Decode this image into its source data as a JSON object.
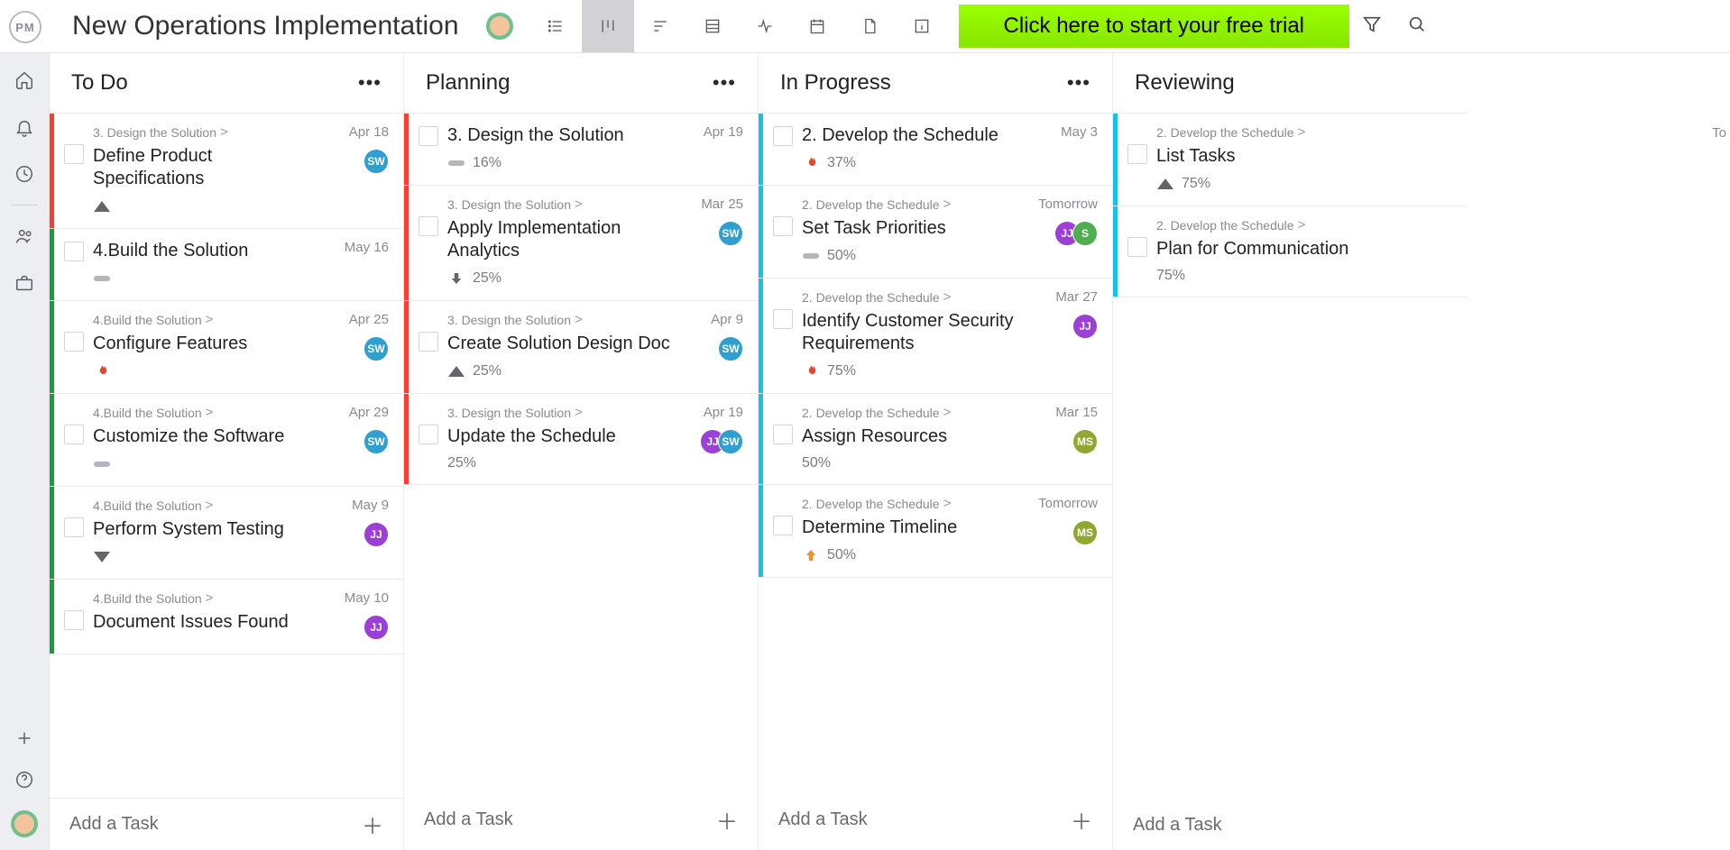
{
  "brand": "PM",
  "project_title": "New Operations Implementation",
  "trial_button": "Click here to start your free trial",
  "add_task_label": "Add a Task",
  "peek_text": "To",
  "columns": [
    {
      "title": "To Do",
      "add_style": "footer",
      "cards": [
        {
          "parent": "3. Design the Solution",
          "title": "Define Product Specifications",
          "date": "Apr 18",
          "pct": "",
          "priority": "up_gray",
          "bar": "red",
          "avatars": [
            "SW"
          ]
        },
        {
          "parent": "",
          "title": "4.Build the Solution",
          "date": "May 16",
          "pct": "",
          "priority": "dash",
          "bar": "green",
          "avatars": []
        },
        {
          "parent": "4.Build the Solution",
          "title": "Configure Features",
          "date": "Apr 25",
          "pct": "",
          "priority": "fire",
          "bar": "green",
          "avatars": [
            "SW"
          ]
        },
        {
          "parent": "4.Build the Solution",
          "title": "Customize the Software",
          "date": "Apr 29",
          "pct": "",
          "priority": "dash",
          "bar": "green",
          "avatars": [
            "SW"
          ]
        },
        {
          "parent": "4.Build the Solution",
          "title": "Perform System Testing",
          "date": "May 9",
          "pct": "",
          "priority": "down_gray",
          "bar": "green",
          "avatars": [
            "JJ"
          ]
        },
        {
          "parent": "4.Build the Solution",
          "title": "Document Issues Found",
          "date": "May 10",
          "pct": "",
          "priority": "",
          "bar": "green",
          "avatars": [
            "JJ"
          ]
        }
      ]
    },
    {
      "title": "Planning",
      "add_style": "inline",
      "cards": [
        {
          "parent": "",
          "title": "3. Design the Solution",
          "date": "Apr 19",
          "pct": "16%",
          "priority": "dash",
          "bar": "red",
          "avatars": []
        },
        {
          "parent": "3. Design the Solution",
          "title": "Apply Implementation Analytics",
          "date": "Mar 25",
          "pct": "25%",
          "priority": "down_thick",
          "bar": "red",
          "avatars": [
            "SW"
          ]
        },
        {
          "parent": "3. Design the Solution",
          "title": "Create Solution Design Doc",
          "date": "Apr 9",
          "pct": "25%",
          "priority": "up_gray",
          "bar": "red",
          "avatars": [
            "SW"
          ]
        },
        {
          "parent": "3. Design the Solution",
          "title": "Update the Schedule",
          "date": "Apr 19",
          "pct": "25%",
          "priority": "",
          "bar": "red",
          "avatars": [
            "JJ",
            "SW"
          ]
        }
      ]
    },
    {
      "title": "In Progress",
      "add_style": "inline",
      "cards": [
        {
          "parent": "",
          "title": "2. Develop the Schedule",
          "date": "May 3",
          "pct": "37%",
          "priority": "fire",
          "bar": "cyan",
          "avatars": []
        },
        {
          "parent": "2. Develop the Schedule",
          "title": "Set Task Priorities",
          "date": "Tomorrow",
          "pct": "50%",
          "priority": "dash",
          "bar": "cyan",
          "avatars": [
            "JJ",
            "S"
          ]
        },
        {
          "parent": "2. Develop the Schedule",
          "title": "Identify Customer Security Requirements",
          "date": "Mar 27",
          "pct": "75%",
          "priority": "fire",
          "bar": "cyan",
          "avatars": [
            "JJ"
          ]
        },
        {
          "parent": "2. Develop the Schedule",
          "title": "Assign Resources",
          "date": "Mar 15",
          "pct": "50%",
          "priority": "",
          "bar": "cyan",
          "avatars": [
            "MS"
          ]
        },
        {
          "parent": "2. Develop the Schedule",
          "title": "Determine Timeline",
          "date": "Tomorrow",
          "pct": "50%",
          "priority": "up_orange",
          "bar": "cyan",
          "avatars": [
            "MS"
          ]
        }
      ]
    },
    {
      "title": "Reviewing",
      "add_style": "inline_nohdr_menu",
      "cards": [
        {
          "parent": "2. Develop the Schedule",
          "title": "List Tasks",
          "date": "",
          "pct": "75%",
          "priority": "up_gray",
          "bar": "cyan",
          "avatars": []
        },
        {
          "parent": "2. Develop the Schedule",
          "title": "Plan for Communication",
          "date": "",
          "pct": "75%",
          "priority": "",
          "bar": "cyan",
          "avatars": []
        }
      ]
    }
  ]
}
